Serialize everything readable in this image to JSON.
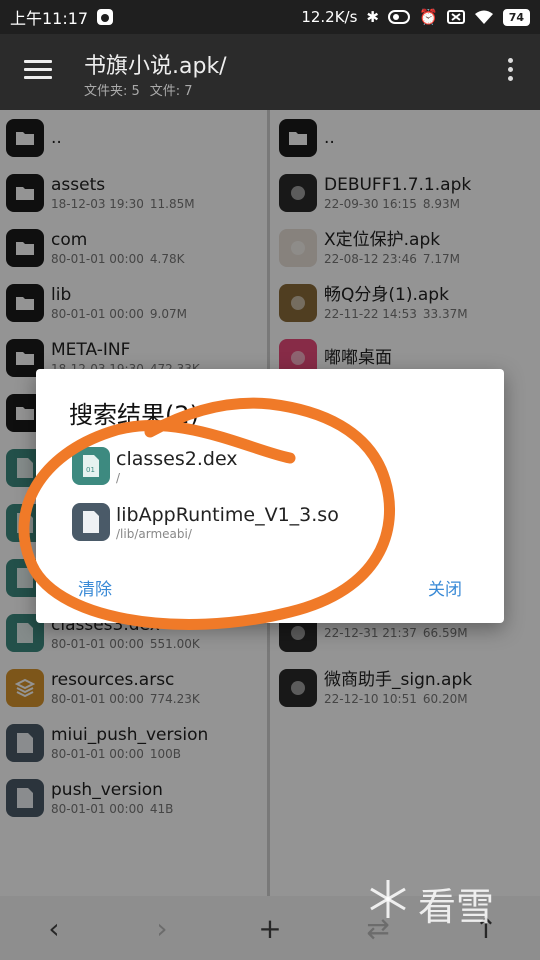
{
  "status_bar": {
    "time": "上午11:17",
    "speed": "12.2K/s",
    "battery": "74"
  },
  "toolbar": {
    "title": "书旗小说.apk/",
    "folders_label": "文件夹: 5",
    "files_label": "文件: 7"
  },
  "left_pane": [
    {
      "name": "..",
      "date": "",
      "size": "",
      "type": "folder"
    },
    {
      "name": "assets",
      "date": "18-12-03 19:30",
      "size": "11.85M",
      "type": "folder"
    },
    {
      "name": "com",
      "date": "80-01-01 00:00",
      "size": "4.78K",
      "type": "folder"
    },
    {
      "name": "lib",
      "date": "80-01-01 00:00",
      "size": "9.07M",
      "type": "folder"
    },
    {
      "name": "META-INF",
      "date": "18-12-03 19:30",
      "size": "472.33K",
      "type": "folder"
    },
    {
      "name": "",
      "date": "",
      "size": "",
      "type": "folder"
    },
    {
      "name": "",
      "date": "",
      "size": "",
      "type": "dex"
    },
    {
      "name": "",
      "date": "",
      "size": "",
      "type": "dex"
    },
    {
      "name": "",
      "date": "",
      "size": "",
      "type": "dex"
    },
    {
      "name": "classes3.dex",
      "date": "80-01-01 00:00",
      "size": "551.00K",
      "type": "dex"
    },
    {
      "name": "resources.arsc",
      "date": "80-01-01 00:00",
      "size": "774.23K",
      "type": "arsc"
    },
    {
      "name": "miui_push_version",
      "date": "80-01-01 00:00",
      "size": "100B",
      "type": "doc"
    },
    {
      "name": "push_version",
      "date": "80-01-01 00:00",
      "size": "41B",
      "type": "doc"
    }
  ],
  "right_pane": [
    {
      "name": "..",
      "date": "",
      "size": "",
      "type": "folder"
    },
    {
      "name": "DEBUFF1.7.1.apk",
      "date": "22-09-30 16:15",
      "size": "8.93M",
      "type": "apk"
    },
    {
      "name": "X定位保护.apk",
      "date": "22-08-12 23:46",
      "size": "7.17M",
      "type": "apk2"
    },
    {
      "name": "畅Q分身(1).apk",
      "date": "22-11-22 14:53",
      "size": "33.37M",
      "type": "apk3"
    },
    {
      "name": "嘟嘟桌面",
      "date": "",
      "size": "",
      "type": "pink"
    },
    {
      "name": "",
      "date": "",
      "size": "",
      "type": "none"
    },
    {
      "name": "",
      "date": "",
      "size": "",
      "type": "none"
    },
    {
      "name": "",
      "date": "",
      "size": "",
      "type": "none"
    },
    {
      "name": "",
      "date": "",
      "size": "",
      "type": "none"
    },
    {
      "name": "",
      "date": "22-12-31 21:37",
      "size": "66.59M",
      "type": "apk"
    },
    {
      "name": "微商助手_sign.apk",
      "date": "22-12-10 10:51",
      "size": "60.20M",
      "type": "apk"
    }
  ],
  "dialog": {
    "title": "搜索结果(2)",
    "results": [
      {
        "name": "classes2.dex",
        "path": "/",
        "type": "dex"
      },
      {
        "name": "libAppRuntime_V1_3.so",
        "path": "/lib/armeabi/",
        "type": "doc"
      }
    ],
    "clear_label": "清除",
    "close_label": "关闭"
  },
  "bottom_bar": {
    "back": "‹",
    "forward": "›",
    "add": "+",
    "swap": "⇄",
    "up": "↑"
  },
  "watermark": "看雪",
  "colors": {
    "accent": "#3a8ad6",
    "annotation": "#f07a28"
  }
}
